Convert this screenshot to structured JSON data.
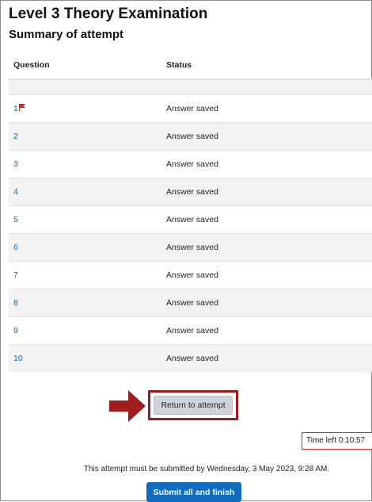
{
  "page": {
    "title": "Level 3 Theory Examination",
    "section_title": "Summary of attempt"
  },
  "table": {
    "headers": {
      "question": "Question",
      "status": "Status"
    },
    "rows": [
      {
        "question": "1",
        "status": "Answer saved",
        "flagged": true
      },
      {
        "question": "2",
        "status": "Answer saved",
        "flagged": false
      },
      {
        "question": "3",
        "status": "Answer saved",
        "flagged": false
      },
      {
        "question": "4",
        "status": "Answer saved",
        "flagged": false
      },
      {
        "question": "5",
        "status": "Answer saved",
        "flagged": false
      },
      {
        "question": "6",
        "status": "Answer saved",
        "flagged": false
      },
      {
        "question": "7",
        "status": "Answer saved",
        "flagged": false
      },
      {
        "question": "8",
        "status": "Answer saved",
        "flagged": false
      },
      {
        "question": "9",
        "status": "Answer saved",
        "flagged": false
      },
      {
        "question": "10",
        "status": "Answer saved",
        "flagged": false
      }
    ]
  },
  "actions": {
    "return_label": "Return to attempt",
    "submit_label": "Submit all and finish"
  },
  "timer": {
    "text": "Time left 0:10:57"
  },
  "deadline_text": "This attempt must be submitted by Wednesday, 3 May 2023, 9:28 AM.",
  "colors": {
    "link": "#0f6cbf",
    "flag": "#d9232d",
    "highlight": "#9b1c1c",
    "primary": "#0f6cbf"
  },
  "icons": {
    "flag": "flag-icon",
    "arrow": "arrow-right-icon"
  }
}
